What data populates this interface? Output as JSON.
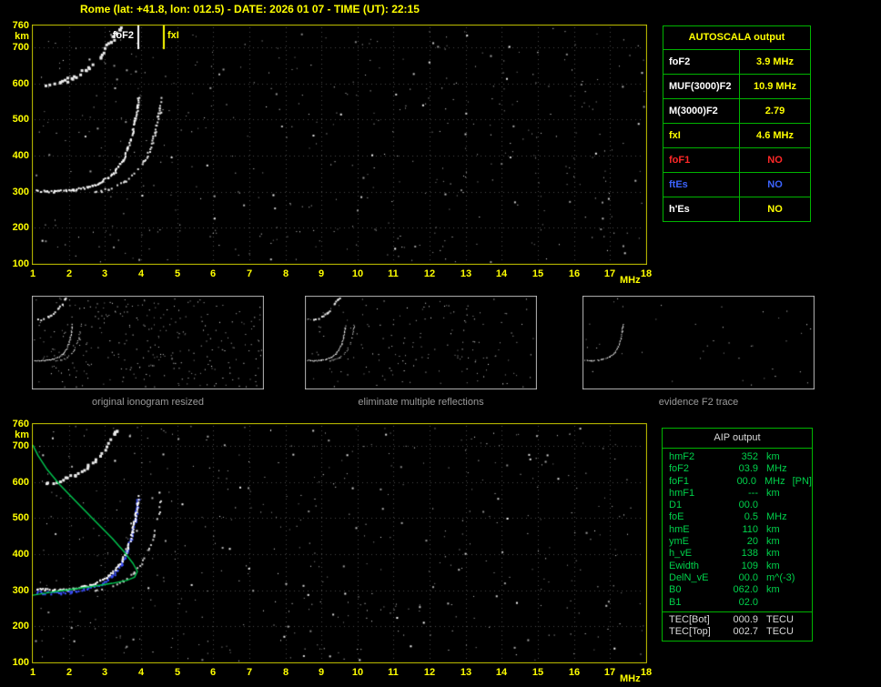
{
  "title": "Rome (lat: +41.8, lon: 012.5) - DATE: 2026 01 07 - TIME (UT): 22:15",
  "colors": {
    "title": "#ffff00",
    "axis_labels": "#ffff00",
    "plot_border": "#c8c800",
    "grid": "#4a4a4a",
    "table_border": "#00b400",
    "profile_green": "#00c850",
    "trace_blue": "#3c50ff",
    "caption_gray": "#9a9a9a",
    "echo_white": "#ffffff"
  },
  "top_ionogram": {
    "x_range": [
      1,
      18
    ],
    "y_range": [
      100,
      760
    ],
    "x_ticks": [
      "1",
      "2",
      "3",
      "4",
      "5",
      "6",
      "7",
      "8",
      "9",
      "10",
      "11",
      "12",
      "13",
      "14",
      "15",
      "16",
      "17",
      "18"
    ],
    "x_unit": "MHz",
    "y_ticks": [
      "760",
      "700",
      "600",
      "500",
      "400",
      "300",
      "200",
      "100"
    ],
    "y_unit": "km",
    "foF2_marker": {
      "label": "foF2",
      "freq": 3.9,
      "color": "#ffffff"
    },
    "fxI_marker": {
      "label": "fxI",
      "freq": 4.6,
      "color": "#ffff00"
    },
    "traces": {
      "f2_ordinary": [
        [
          1.1,
          305
        ],
        [
          1.6,
          302
        ],
        [
          2.1,
          306
        ],
        [
          2.5,
          314
        ],
        [
          2.9,
          329
        ],
        [
          3.2,
          350
        ],
        [
          3.45,
          383
        ],
        [
          3.62,
          422
        ],
        [
          3.75,
          465
        ],
        [
          3.83,
          510
        ],
        [
          3.88,
          540
        ],
        [
          3.9,
          562
        ]
      ],
      "f2_extraordinary": [
        [
          2.7,
          300
        ],
        [
          3.1,
          309
        ],
        [
          3.5,
          327
        ],
        [
          3.8,
          351
        ],
        [
          4.05,
          384
        ],
        [
          4.25,
          423
        ],
        [
          4.38,
          468
        ],
        [
          4.47,
          512
        ],
        [
          4.52,
          540
        ],
        [
          4.55,
          562
        ]
      ],
      "second_hop": [
        [
          1.35,
          598
        ],
        [
          1.7,
          604
        ],
        [
          2.1,
          618
        ],
        [
          2.5,
          643
        ],
        [
          2.85,
          678
        ],
        [
          3.1,
          712
        ],
        [
          3.3,
          743
        ],
        [
          3.42,
          760
        ]
      ]
    }
  },
  "autoscala_table": {
    "title": "AUTOSCALA output",
    "rows": [
      {
        "label": "foF2",
        "value": "3.9 MHz",
        "label_color": "#ffffff",
        "value_color": "#ffff00"
      },
      {
        "label": "MUF(3000)F2",
        "value": "10.9 MHz",
        "label_color": "#ffffff",
        "value_color": "#ffff00"
      },
      {
        "label": "M(3000)F2",
        "value": "2.79",
        "label_color": "#ffffff",
        "value_color": "#ffff00"
      },
      {
        "label": "fxI",
        "value": "4.6 MHz",
        "label_color": "#ffff00",
        "value_color": "#ffff00"
      },
      {
        "label": "foF1",
        "value": "NO",
        "label_color": "#ff2828",
        "value_color": "#ff2828"
      },
      {
        "label": "ftEs",
        "value": "NO",
        "label_color": "#3c64ff",
        "value_color": "#3c64ff"
      },
      {
        "label": "h'Es",
        "value": "NO",
        "label_color": "#ffffff",
        "value_color": "#ffff00"
      }
    ]
  },
  "thumbnails": [
    {
      "caption": "original ionogram resized",
      "show": [
        "second_hop",
        "f2_extraordinary",
        "f2_ordinary"
      ],
      "noise": 300
    },
    {
      "caption": "eliminate multiple reflections",
      "show": [
        "second_hop",
        "f2_extraordinary",
        "f2_ordinary"
      ],
      "noise": 160
    },
    {
      "caption": "evidence F2 trace",
      "show": [
        "f2_ordinary"
      ],
      "noise": 40
    }
  ],
  "bottom_ionogram": {
    "x_range": [
      1,
      18
    ],
    "y_range": [
      100,
      760
    ],
    "x_ticks": [
      "1",
      "2",
      "3",
      "4",
      "5",
      "6",
      "7",
      "8",
      "9",
      "10",
      "11",
      "12",
      "13",
      "14",
      "15",
      "16",
      "17",
      "18"
    ],
    "x_unit": "MHz",
    "y_ticks": [
      "760",
      "700",
      "600",
      "500",
      "400",
      "300",
      "200",
      "100"
    ],
    "y_unit": "km",
    "traces": {
      "f2_ordinary": [
        [
          1.1,
          305
        ],
        [
          1.6,
          302
        ],
        [
          2.1,
          306
        ],
        [
          2.5,
          314
        ],
        [
          2.9,
          329
        ],
        [
          3.2,
          350
        ],
        [
          3.45,
          383
        ],
        [
          3.62,
          422
        ],
        [
          3.75,
          465
        ],
        [
          3.83,
          510
        ],
        [
          3.88,
          540
        ],
        [
          3.9,
          562
        ]
      ],
      "f2_extraordinary": [
        [
          2.7,
          300
        ],
        [
          3.1,
          309
        ],
        [
          3.5,
          327
        ],
        [
          3.8,
          351
        ],
        [
          4.05,
          384
        ],
        [
          4.25,
          423
        ],
        [
          4.38,
          468
        ],
        [
          4.47,
          512
        ],
        [
          4.52,
          540
        ],
        [
          4.55,
          562
        ]
      ],
      "second_hop": [
        [
          1.35,
          598
        ],
        [
          1.7,
          604
        ],
        [
          2.1,
          618
        ],
        [
          2.5,
          643
        ],
        [
          2.85,
          678
        ],
        [
          3.1,
          712
        ],
        [
          3.3,
          743
        ],
        [
          3.42,
          760
        ]
      ]
    },
    "profile": [
      [
        1.0,
        702
      ],
      [
        1.15,
        672
      ],
      [
        1.4,
        634
      ],
      [
        1.75,
        592
      ],
      [
        2.2,
        545
      ],
      [
        2.7,
        494
      ],
      [
        3.2,
        444
      ],
      [
        3.55,
        404
      ],
      [
        3.78,
        374
      ],
      [
        3.9,
        352
      ],
      [
        3.82,
        336
      ],
      [
        3.6,
        327
      ],
      [
        3.2,
        319
      ],
      [
        2.7,
        311
      ],
      [
        2.2,
        304
      ],
      [
        1.7,
        297
      ],
      [
        1.3,
        291
      ],
      [
        1.0,
        286
      ]
    ]
  },
  "aip_table": {
    "title": "AIP output",
    "rows": [
      {
        "label": "hmF2",
        "value": "352",
        "unit": "km"
      },
      {
        "label": "foF2",
        "value": "03.9",
        "unit": "MHz"
      },
      {
        "label": "foF1",
        "value": "00.0",
        "unit": "MHz",
        "extra": "[PN]"
      },
      {
        "label": "hmF1",
        "value": "---",
        "unit": "km"
      },
      {
        "label": "D1",
        "value": "00.0",
        "unit": ""
      },
      {
        "label": "foE",
        "value": "0.5",
        "unit": "MHz"
      },
      {
        "label": "hmE",
        "value": "110",
        "unit": "km"
      },
      {
        "label": "ymE",
        "value": "20",
        "unit": "km"
      },
      {
        "label": "h_vE",
        "value": "138",
        "unit": "km"
      },
      {
        "label": "Ewidth",
        "value": "109",
        "unit": "km"
      },
      {
        "label": "DelN_vE",
        "value": "00.0",
        "unit": "m^(-3)"
      },
      {
        "label": "B0",
        "value": "062.0",
        "unit": "km"
      },
      {
        "label": "B1",
        "value": "02.0",
        "unit": ""
      }
    ],
    "tec_rows": [
      {
        "label": "TEC[Bot]",
        "value": "000.9",
        "unit": "TECU"
      },
      {
        "label": "TEC[Top]",
        "value": "002.7",
        "unit": "TECU"
      }
    ]
  }
}
